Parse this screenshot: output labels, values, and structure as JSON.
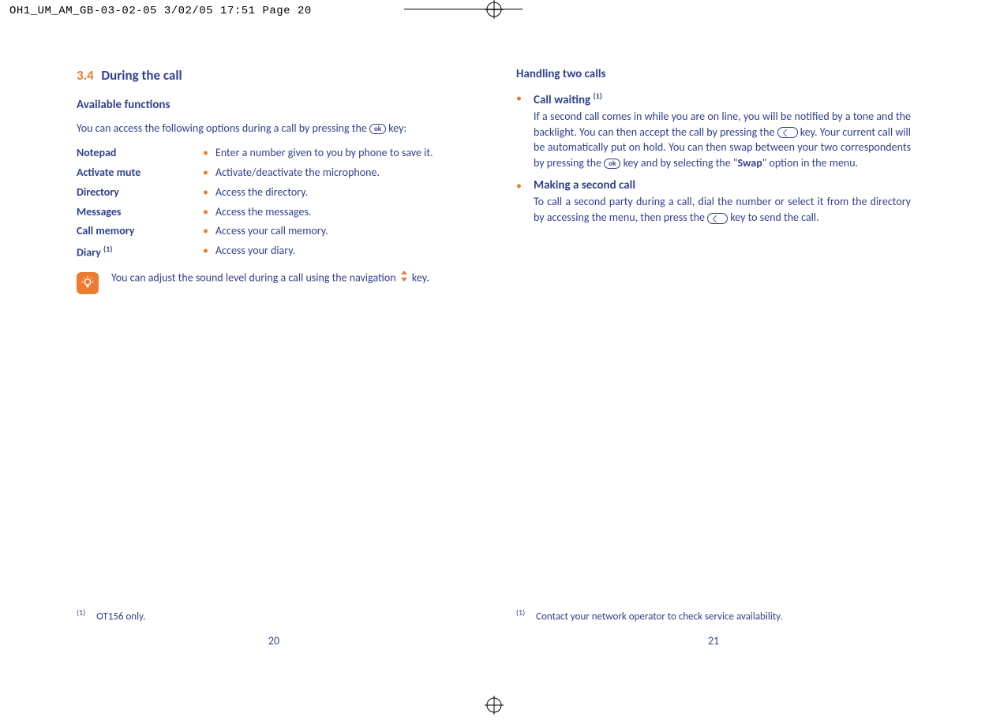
{
  "print_header": "OH1_UM_AM_GB-03-02-05   3/02/05  17:51  Page 20",
  "left": {
    "section_num": "3.4",
    "section_title": "During the call",
    "subheading": "Available functions",
    "intro_a": "You can access the following options during a call by pressing the ",
    "intro_b": " key:",
    "key_ok": "ok",
    "functions": [
      {
        "label": "Notepad",
        "desc": "Enter a number given to you by phone to save it."
      },
      {
        "label": "Activate mute",
        "desc": "Activate/deactivate the microphone."
      },
      {
        "label": "Directory",
        "desc": "Access the directory."
      },
      {
        "label": "Messages",
        "desc": "Access the messages."
      },
      {
        "label": "Call memory",
        "desc": "Access your call memory."
      },
      {
        "label": "Diary ",
        "sup": "(1)",
        "desc": "Access your diary."
      }
    ],
    "tip_a": "You can adjust the sound level during a call using the navigation ",
    "tip_b": " key.",
    "footnote_sup": "(1)",
    "footnote": "OT156 only.",
    "pagenum": "20"
  },
  "right": {
    "heading": "Handling two calls",
    "item1": {
      "title": "Call waiting ",
      "sup": "(1)",
      "p1a": "If a second call comes in while you are on line, you will be notified by a tone and the backlight. You can then accept the call by pressing the ",
      "p1b": " key. Your current call will be automatically put on hold. You can then swap between your two correspondents by pressing the ",
      "p1c": " key and by selecting the \"",
      "swap": "Swap",
      "p1d": "\" option in the menu."
    },
    "item2": {
      "title": "Making a second call",
      "p1a": "To call a second party during a call, dial the number or select it from the directory by accessing the menu, then press the ",
      "p1b": " key to send the call."
    },
    "key_ok": "ok",
    "footnote_sup": "(1)",
    "footnote": "Contact your network operator to check service availability.",
    "pagenum": "21"
  }
}
